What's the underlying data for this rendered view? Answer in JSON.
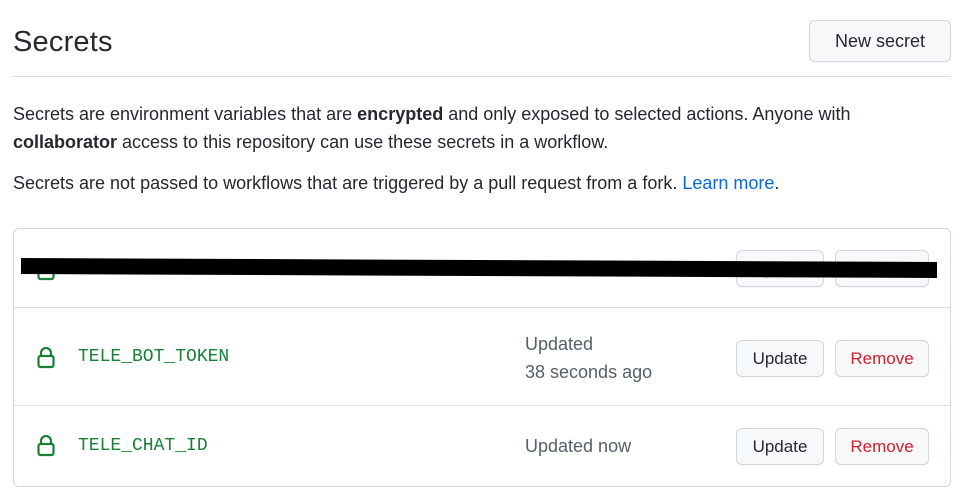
{
  "header": {
    "title": "Secrets",
    "new_secret_label": "New secret"
  },
  "description": {
    "p1_a": "Secrets are environment variables that are ",
    "p1_b": "encrypted",
    "p1_c": " and only exposed to selected actions. Anyone with ",
    "p1_d": "collaborator",
    "p1_e": " access to this repository can use these secrets in a workflow.",
    "p2_a": "Secrets are not passed to workflows that are triggered by a pull request from a fork. ",
    "p2_link": "Learn more",
    "p2_b": "."
  },
  "secrets": [
    {
      "name": "",
      "updated_line1": "",
      "updated_line2": "",
      "update_label": "Update",
      "remove_label": "Remove",
      "redacted": true
    },
    {
      "name": "TELE_BOT_TOKEN",
      "updated_line1": "Updated",
      "updated_line2": "38 seconds ago",
      "update_label": "Update",
      "remove_label": "Remove"
    },
    {
      "name": "TELE_CHAT_ID",
      "updated_line1": "Updated now",
      "updated_line2": "",
      "update_label": "Update",
      "remove_label": "Remove"
    }
  ],
  "colors": {
    "accent_green": "#1a7f37",
    "link_blue": "#0969da",
    "danger_red": "#cf222e"
  },
  "icons": {
    "secret": "lock-icon"
  }
}
